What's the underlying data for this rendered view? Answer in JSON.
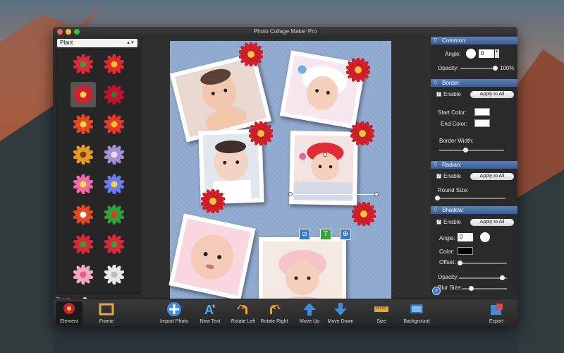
{
  "window": {
    "title": "Photo Collage Maker Pro"
  },
  "left_panel": {
    "category_dropdown": "Plant",
    "zoom_label": "Zoom:",
    "items": [
      {
        "icon": "bouquet-icon"
      },
      {
        "icon": "red-blossom-icon"
      },
      {
        "icon": "red-daisy-icon",
        "selected": true
      },
      {
        "icon": "red-rose-icon"
      },
      {
        "icon": "orange-flower-icon"
      },
      {
        "icon": "red-yellow-flower-icon"
      },
      {
        "icon": "sunflower-icon"
      },
      {
        "icon": "purple-rose-icon"
      },
      {
        "icon": "pink-flower-icon"
      },
      {
        "icon": "blue-flower-icon"
      },
      {
        "icon": "cartoon-flower-icon"
      },
      {
        "icon": "potted-plant-icon"
      },
      {
        "icon": "red-bud-icon"
      },
      {
        "icon": "red-stem-flower-icon"
      },
      {
        "icon": "pink-blossom-icon"
      },
      {
        "icon": "dandelion-icon"
      }
    ]
  },
  "right_panel": {
    "common": {
      "header": "Common:",
      "angle_label": "Angle:",
      "angle_value": "0",
      "opacity_label": "Opacity:",
      "opacity_value": "100%"
    },
    "border": {
      "header": "Border:",
      "enable_label": "Enable",
      "apply_all": "Apply to All",
      "start_color_label": "Start Color:",
      "end_color_label": "End Color:",
      "width_label": "Border Width:"
    },
    "radian": {
      "header": "Radian:",
      "enable_label": "Enable",
      "apply_all": "Apply to All",
      "round_size_label": "Round Size:"
    },
    "shadow": {
      "header": "Shadow:",
      "enable_label": "Enable",
      "apply_all": "Apply to All",
      "angle_label": "Angle:",
      "angle_value": "0",
      "color_label": "Color:",
      "offset_label": "Offset:",
      "opacity_label": "Opacity:",
      "blur_label": "Blur Size:"
    }
  },
  "toolbar": {
    "element": "Element",
    "frame": "Frame",
    "import_photo": "Import Photo",
    "new_text": "New Text",
    "rotate_left": "Rotate Left",
    "rotate_right": "Rotate Right",
    "move_up": "Move Up",
    "move_down": "Move Down",
    "size": "Size",
    "background": "Background",
    "export": "Export"
  },
  "colors": {
    "section_header": "#4a6ea6",
    "canvas_bg": "#8fa8cf",
    "accent_red": "#d61f2a"
  }
}
